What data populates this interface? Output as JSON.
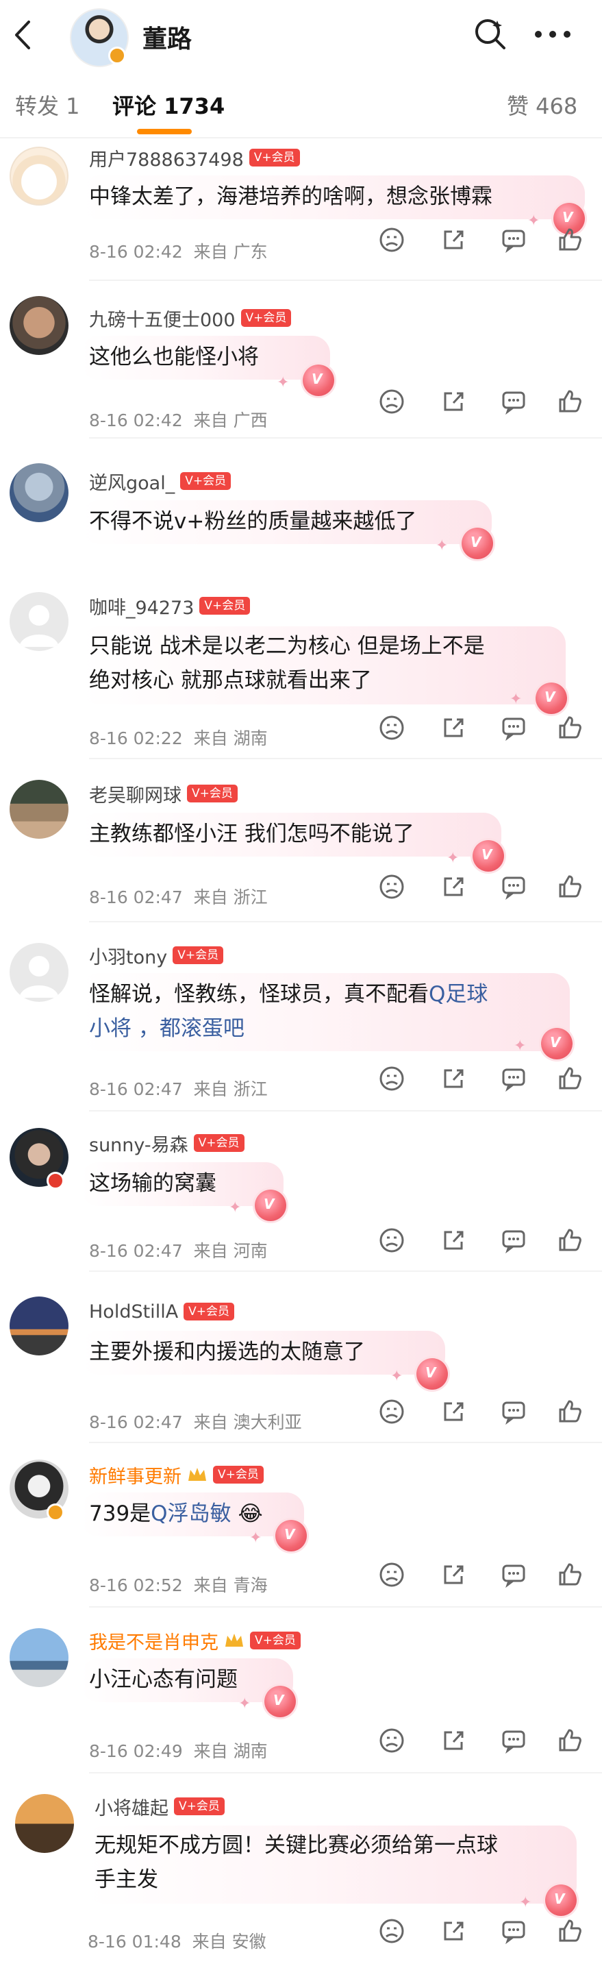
{
  "header": {
    "title": "董路"
  },
  "tabs": {
    "repost": "转发 1",
    "comments": "评论 1734",
    "likes": "赞 468"
  },
  "vip_label": "V+会员",
  "comments": [
    {
      "user": "用户7888637498",
      "text": [
        "中锋太差了，海港培养的啥啊，想念张博霖"
      ],
      "time": "8-16 02:42",
      "loc": "来自 广东"
    },
    {
      "user": "九磅十五便士000",
      "text": [
        "这他么也能怪小将"
      ],
      "time": "8-16 02:42",
      "loc": "来自 广西"
    },
    {
      "user": "逆风goal_",
      "text": [
        "不得不说v+粉丝的质量越来越低了"
      ],
      "time": "",
      "loc": ""
    },
    {
      "user": "咖啡_94273",
      "text": [
        "只能说 战术是以老二为核心  但是场上不是",
        "绝对核心 就那点球就看出来了"
      ],
      "time": "8-16 02:22",
      "loc": "来自 湖南"
    },
    {
      "user": "老吴聊网球",
      "text": [
        "主教练都怪小汪 我们怎吗不能说了"
      ],
      "time": "8-16 02:47",
      "loc": "来自 浙江"
    },
    {
      "user": "小羽tony",
      "text_prefix": "怪解说，怪教练，怪球员，真不配看",
      "link": "足球",
      "text2": "小将 ，都滚蛋吧",
      "time": "8-16 02:47",
      "loc": "来自 浙江"
    },
    {
      "user": "sunny-易森",
      "text": [
        "这场输的窝囊"
      ],
      "time": "8-16 02:47",
      "loc": "来自 河南"
    },
    {
      "user": "HoldStillA",
      "text": [
        "主要外援和内援选的太随意了"
      ],
      "time": "8-16 02:47",
      "loc": "来自 澳大利亚"
    },
    {
      "user": "新鲜事更新",
      "text_prefix": "739是",
      "link": "浮岛敏",
      "emoji": "😂",
      "time": "8-16 02:52",
      "loc": "来自 青海"
    },
    {
      "user": "我是不是肖申克",
      "text": [
        "小汪心态有问题"
      ],
      "time": "8-16 02:49",
      "loc": "来自 湖南"
    },
    {
      "user": "小将雄起",
      "text": [
        "无规矩不成方圆！关键比赛必须给第一点球",
        "手主发"
      ],
      "time": "8-16 01:48",
      "loc": "来自 安徽"
    }
  ],
  "colors": {
    "accent": "#ff8a00",
    "vip": "#f04540",
    "link": "#3a5fa0",
    "bubble": "#fde4ea"
  }
}
